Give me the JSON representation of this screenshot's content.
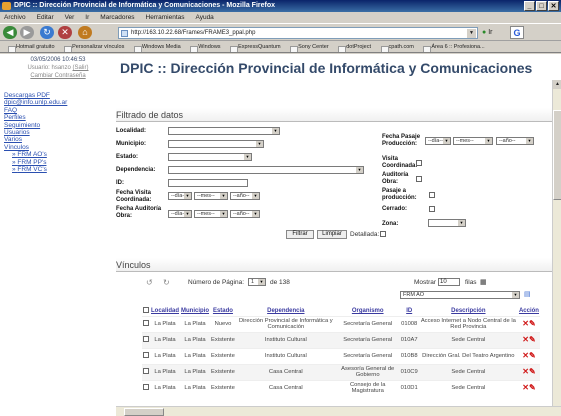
{
  "window": {
    "title": "DPIC :: Dirección Provincial de Informática y Comunicaciones - Mozilla Firefox",
    "buttons": [
      "_",
      "□",
      "✕"
    ]
  },
  "menu": [
    "Archivo",
    "Editar",
    "Ver",
    "Ir",
    "Marcadores",
    "Herramientas",
    "Ayuda"
  ],
  "nav": {
    "url": "http://163.10.22.68/Frames/FRAME3_ppal.php",
    "go_label": "Ir"
  },
  "bookmarks": [
    "Hotmail gratuito",
    "Personalizar vínculos",
    "Windows Media",
    "Windows",
    "ExpressQuantum",
    "Sony Center",
    "dotProject",
    "cpath.com",
    "Área 6 :: Profesiona..."
  ],
  "session": {
    "datetime": "03/05/2006  10:46:53",
    "user_label": "Usuario:",
    "user": "hsanzo",
    "logout": "(Salir)",
    "change_password": "Cambiar Contraseña"
  },
  "header": {
    "title": "DPIC :: Dirección Provincial de Informática y Comunicaciones"
  },
  "sidebar": {
    "items": [
      "Descargas PDF",
      "dpic@info.unlp.edu.ar",
      "FAQ",
      "Perfiles",
      "Seguimiento",
      "Usuarios",
      "Varios",
      "Vínculos"
    ],
    "subitems": [
      "FRM AO's",
      "FRM PP's",
      "FRM VC's"
    ]
  },
  "filter": {
    "title": "Filtrado de datos",
    "labels": {
      "localidad": "Localidad:",
      "municipio": "Municipio:",
      "estado": "Estado:",
      "dependencia": "Dependencia:",
      "id": "ID:",
      "fecha_visita": "Fecha Visita Coordinada:",
      "fecha_auditoria": "Fecha Auditoría Obra:",
      "fecha_pasaje": "Fecha Pasaje Producción:",
      "visita": "Visita Coordinada:",
      "auditoria": "Auditoría Obra:",
      "pasaje": "Pasaje a producción:",
      "cerrado": "Cerrado:",
      "zona": "Zona:"
    },
    "date_placeholders": {
      "dia": "--día--",
      "mes": "--mes--",
      "anio": "--año--"
    },
    "buttons": {
      "filter": "Filtrar",
      "clear": "Limpiar"
    },
    "detailed_label": "Detallada:"
  },
  "links_section": {
    "title": "Vínculos",
    "page_label": "Número de Página:",
    "page": "1",
    "of_label": "de 138",
    "show_label": "Mostrar",
    "show_value": "10",
    "rows_label": "filas",
    "form_select": "FRM AO"
  },
  "table": {
    "headers": [
      "Localidad",
      "Municipio",
      "Estado",
      "Dependencia",
      "Organismo",
      "ID",
      "Descripción",
      "Acción"
    ],
    "rows": [
      [
        "La Plata",
        "La Plata",
        "Nuevo",
        "Dirección Provincial de Informática y Comunicación",
        "Secretaría General",
        "01008",
        "Acceso Internet a Nodo Central de la Red Provincia"
      ],
      [
        "La Plata",
        "La Plata",
        "Existente",
        "Instituto Cultural",
        "Secretaría General",
        "010A7",
        "Sede Central"
      ],
      [
        "La Plata",
        "La Plata",
        "Existente",
        "Instituto Cultural",
        "Secretaría General",
        "010B8",
        "Dirección Gral. Del Teatro Argentino"
      ],
      [
        "La Plata",
        "La Plata",
        "Existente",
        "Casa Central",
        "Asesoría General de Gobierno",
        "010C9",
        "Sede Central"
      ],
      [
        "La Plata",
        "La Plata",
        "Existente",
        "Casa Central",
        "Consejo de la Magistratura",
        "010D1",
        "Sede Central"
      ]
    ]
  }
}
